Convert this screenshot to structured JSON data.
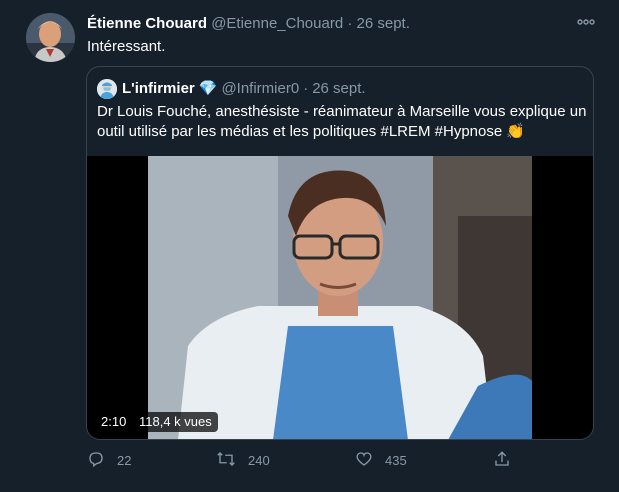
{
  "tweet": {
    "author_name": "Étienne Chouard",
    "author_handle": "@Etienne_Chouard",
    "separator": "·",
    "date": "26 sept.",
    "text": "Intéressant.",
    "more_icon": "more-dots-icon",
    "avatar_icon": "avatar"
  },
  "quoted": {
    "author_name": "L'infirmier",
    "badge": "💎",
    "author_handle": "@Infirmier0",
    "separator": "·",
    "date": "26 sept.",
    "text": "Dr Louis Fouché, anesthésiste - réanimateur à Marseille vous explique un outil utilisé par les médias et les politiques #LREM #Hypnose 👏",
    "video": {
      "duration": "2:10",
      "views": "118,4 k vues"
    }
  },
  "actions": {
    "reply_count": "22",
    "retweet_count": "240",
    "like_count": "435",
    "reply_icon": "reply-icon",
    "retweet_icon": "retweet-icon",
    "like_icon": "heart-icon",
    "share_icon": "share-icon"
  },
  "colors": {
    "background": "#15202b",
    "text": "#ffffff",
    "muted": "#8899a6",
    "border": "#38444d",
    "hashtag": "#ffffff"
  }
}
